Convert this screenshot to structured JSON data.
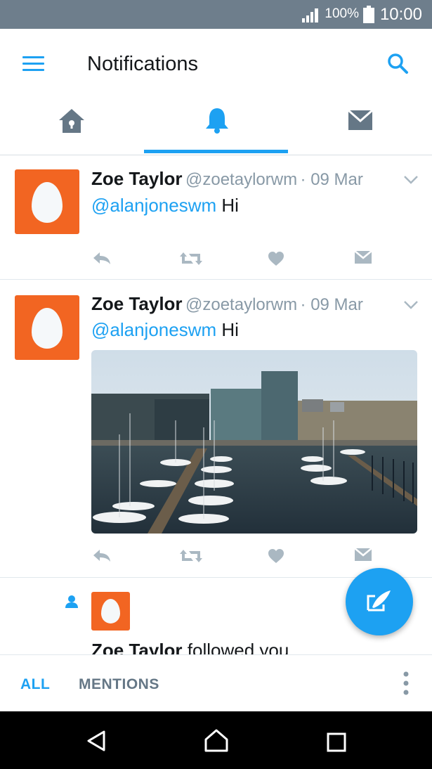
{
  "status_bar": {
    "battery_percent": "100%",
    "time": "10:00",
    "icons": [
      "signal-icon",
      "battery-icon"
    ]
  },
  "app_bar": {
    "title": "Notifications",
    "menu_icon": "hamburger-menu-icon",
    "search_icon": "search-icon"
  },
  "tabs": [
    {
      "name": "home",
      "icon": "home-icon",
      "active": false
    },
    {
      "name": "notifications",
      "icon": "bell-icon",
      "active": true
    },
    {
      "name": "messages",
      "icon": "envelope-icon",
      "active": false
    }
  ],
  "notifications": [
    {
      "type": "tweet",
      "name": "Zoe Taylor",
      "handle": "@zoetaylorwm",
      "date": "· 09 Mar",
      "mention": "@alanjoneswm",
      "text": "Hi",
      "has_image": false
    },
    {
      "type": "tweet",
      "name": "Zoe Taylor",
      "handle": "@zoetaylorwm",
      "date": "· 09 Mar",
      "mention": "@alanjoneswm",
      "text": "Hi",
      "has_image": true,
      "image_description": "harbour-photo"
    },
    {
      "type": "follow",
      "name": "Zoe Taylor",
      "text": "followed you"
    }
  ],
  "bottom_tabs": {
    "all": "ALL",
    "mentions": "MENTIONS"
  },
  "colors": {
    "accent": "#1da1f2",
    "avatar_orange": "#f26522",
    "status_bar": "#6e7e8c",
    "icon_gray": "#657786"
  }
}
